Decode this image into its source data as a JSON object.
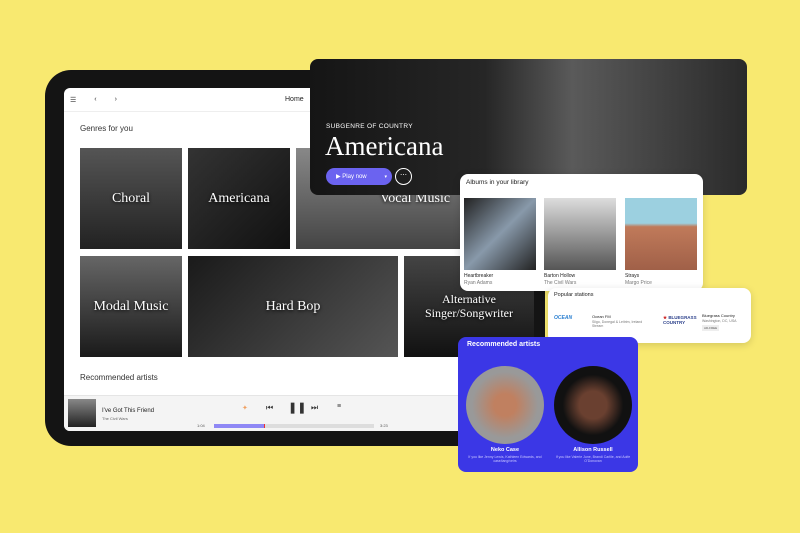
{
  "nav": {
    "home": "Home"
  },
  "genres": {
    "title": "Genres for you",
    "items": [
      "Choral",
      "Americana",
      "Vocal Music",
      "Modal Music",
      "Hard Bop",
      "Alternative Singer/Songwriter"
    ]
  },
  "recommended_label": "Recommended artists",
  "player": {
    "track": "I've Got This Friend",
    "artist": "The Civil Wars",
    "elapsed": "1:04",
    "duration": "3:23",
    "progress": 0.32
  },
  "hero": {
    "eyebrow": "SUBGENRE OF COUNTRY",
    "title": "Americana",
    "play": "Play now"
  },
  "albums": {
    "title": "Albums in your library",
    "items": [
      {
        "name": "Heartbreaker",
        "artist": "Ryan Adams"
      },
      {
        "name": "Barton Hollow",
        "artist": "The Civil Wars"
      },
      {
        "name": "Strays",
        "artist": "Margo Price"
      }
    ]
  },
  "stations": {
    "title": "Popular stations",
    "items": [
      {
        "name": "Ocean FM",
        "location": "Sligo, Donegal & Leitrim, Ireland",
        "type": "Stream",
        "logo": "OCEAN"
      },
      {
        "name": "Bluegrass Country",
        "location": "Washington, DC, USA",
        "type": "AD-FREE",
        "logo": "BLUEGRASS COUNTRY"
      }
    ]
  },
  "artists": {
    "title": "Recommended artists",
    "items": [
      {
        "name": "Neko Case",
        "desc": "If you like Jenny Lewis, Kathleen Edwards, and case/lang/veirs"
      },
      {
        "name": "Allison Russell",
        "desc": "If you like Valerie June, Brandi Carlile, and Aoife O'Donovan"
      }
    ]
  },
  "colors": {
    "background": "#f8e970",
    "accent": "#6b63f0",
    "artists_card": "#3b37e6"
  }
}
